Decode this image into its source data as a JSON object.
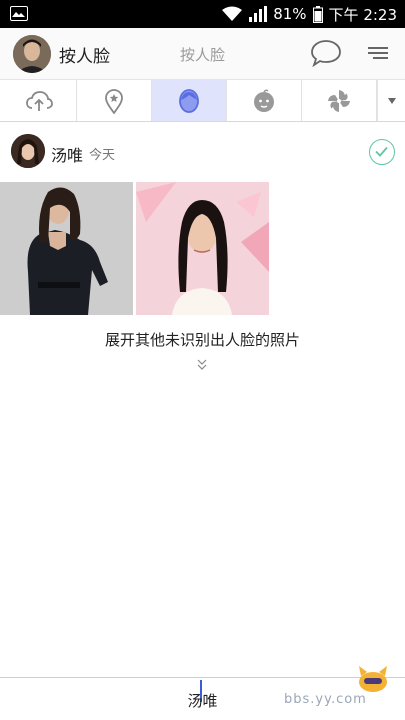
{
  "status_bar": {
    "battery": "81%",
    "time": "下午 2:23"
  },
  "header": {
    "app_title": "按人脸",
    "center_title": "按人脸"
  },
  "tabs": [
    {
      "icon": "cloud-upload-icon",
      "active": false
    },
    {
      "icon": "location-pin-icon",
      "active": false
    },
    {
      "icon": "face-icon",
      "active": true
    },
    {
      "icon": "baby-face-icon",
      "active": false
    },
    {
      "icon": "pinwheel-icon",
      "active": false
    }
  ],
  "person": {
    "name": "汤唯",
    "date": "今天"
  },
  "expand": {
    "label": "展开其他未识别出人脸的照片"
  },
  "bottom": {
    "name": "汤唯"
  },
  "watermark": "bbs.yy.com",
  "colors": {
    "accent": "#5b6ee1",
    "active_tab_bg": "#dfe3fb",
    "check": "#5cc8a3"
  }
}
